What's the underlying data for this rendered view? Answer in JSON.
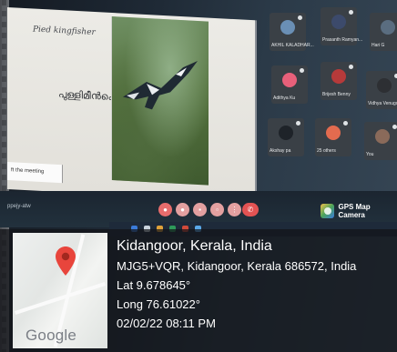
{
  "slide": {
    "title": "Pied kingfisher",
    "local_name": "പുള്ളിമീൻകൊത്തി"
  },
  "meeting_strip": {
    "label": "ft the meeting",
    "call_id": "ppejy-atw"
  },
  "participants": [
    {
      "name": "AKHIL KALADHAR...",
      "avatar_color": "#6a8fb5"
    },
    {
      "name": "Prasanth Ramyan...",
      "avatar_color": "#3c4a6b"
    },
    {
      "name": "Hari G",
      "avatar_color": "#5a6d80"
    },
    {
      "name": "Adithya Ku",
      "avatar_color": "#e8607a"
    },
    {
      "name": "Brijesh Benny",
      "avatar_color": "#b63a3a"
    },
    {
      "name": "Vidhya Venugopal",
      "avatar_color": "#2d2f33"
    },
    {
      "name": "Akshay pa",
      "avatar_color": "#1e2329"
    },
    {
      "name": "25 others",
      "avatar_color": "#e36b4f"
    },
    {
      "name": "You",
      "avatar_color": "#8a6a5a"
    }
  ],
  "call_controls": {
    "buttons": [
      "mic",
      "cam",
      "cc",
      "present",
      "more"
    ],
    "leave_icon": "end-call-icon"
  },
  "gps_app": {
    "name": "GPS Map Camera"
  },
  "location": {
    "place": "Kidangoor, Kerala, India",
    "address": "MJG5+VQR, Kidangoor, Kerala 686572, India",
    "lat": "Lat 9.678645°",
    "long": "Long 76.61022°",
    "datetime": "02/02/22 08:11 PM"
  },
  "map": {
    "brand": "Google",
    "pin_color": "#e8453c"
  }
}
